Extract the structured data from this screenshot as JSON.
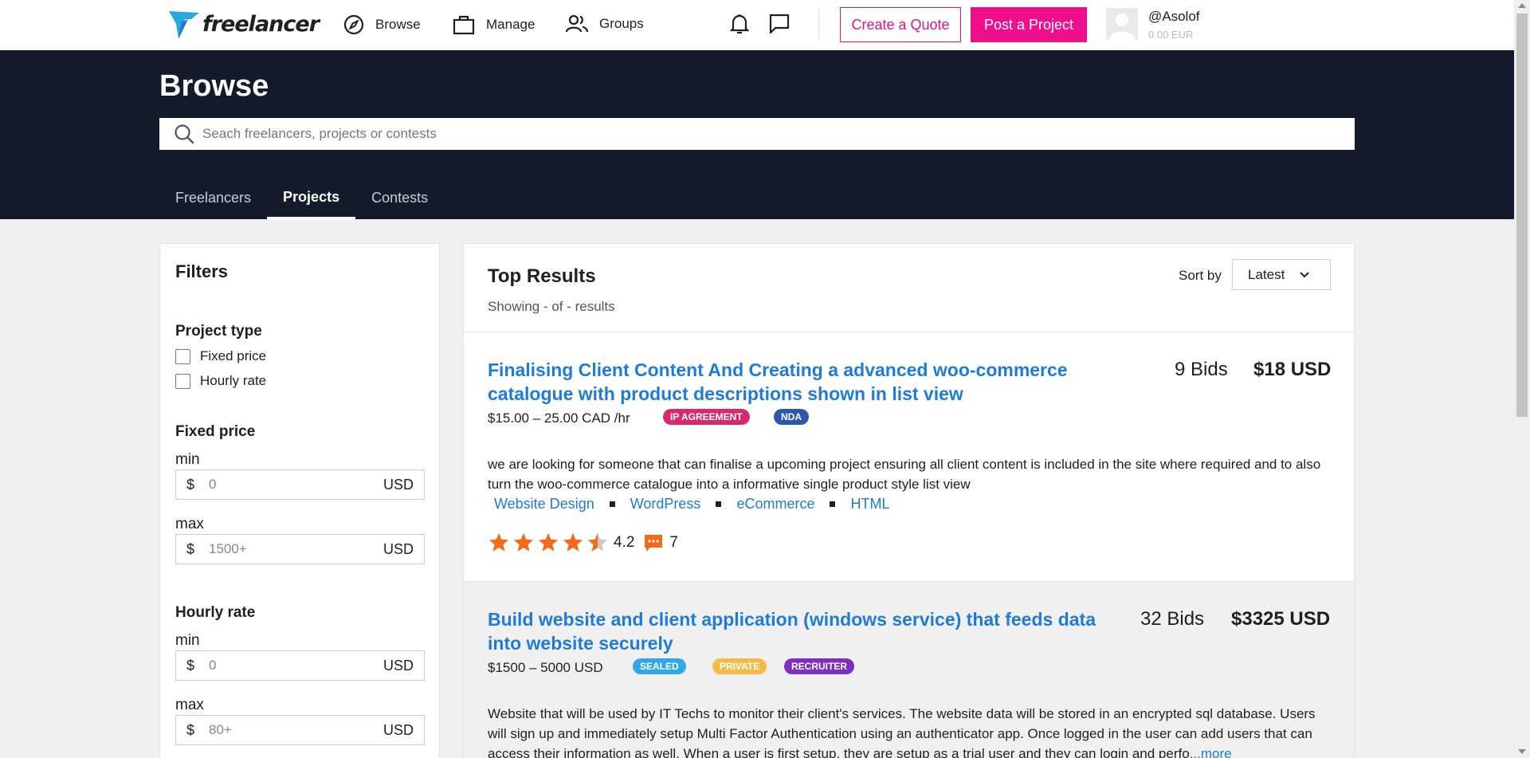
{
  "brand": {
    "name": "freelancer"
  },
  "nav": {
    "browse": "Browse",
    "manage": "Manage",
    "groups": "Groups",
    "create_quote": "Create a Quote",
    "post_project": "Post a Project",
    "username": "@Asolof",
    "balance": "0.00 EUR"
  },
  "header": {
    "title": "Browse",
    "search_placeholder": "Seach freelancers, projects or contests",
    "tabs": [
      {
        "label": "Freelancers",
        "active": false
      },
      {
        "label": "Projects",
        "active": true
      },
      {
        "label": "Contests",
        "active": false
      }
    ]
  },
  "filters": {
    "title": "Filters",
    "project_type": {
      "title": "Project type",
      "options": [
        "Fixed price",
        "Hourly rate"
      ]
    },
    "fixed_price": {
      "title": "Fixed price",
      "min_label": "min",
      "max_label": "max",
      "min_placeholder": "0",
      "max_placeholder": "1500+",
      "currency_symbol": "$",
      "currency": "USD"
    },
    "hourly_rate": {
      "title": "Hourly rate",
      "min_label": "min",
      "max_label": "max",
      "min_placeholder": "0",
      "max_placeholder": "80+",
      "currency_symbol": "$",
      "currency": "USD"
    }
  },
  "results": {
    "title": "Top Results",
    "count": "Showing - of - results",
    "sort_label": "Sort by",
    "sort_value": "Latest",
    "projects": [
      {
        "title": "Finalising Client Content And Creating a advanced woo-commerce catalogue with product descriptions shown in list view",
        "bids": "9 Bids",
        "price": "$18 USD",
        "budget": "$15.00 – 25.00 CAD /hr",
        "badges": [
          {
            "label": "IP AGREEMENT",
            "color": "#d9286c"
          },
          {
            "label": "NDA",
            "color": "#2b58ab"
          }
        ],
        "description": "we are looking for someone that can finalise a upcoming project ensuring all client content is included in the site where required and to also turn the woo-commerce catalogue into a informative single product style list view",
        "skills": [
          "Website Design",
          "WordPress",
          "eCommerce",
          "HTML"
        ],
        "rating": "4.2",
        "rating_value": 4.2,
        "reviews": "7"
      },
      {
        "title": "Build website and client application (windows service) that feeds data into website securely",
        "bids": "32 Bids",
        "price": "$3325 USD",
        "budget": "$1500 – 5000 USD",
        "badges": [
          {
            "label": "SEALED",
            "color": "#32a8e8"
          },
          {
            "label": "PRIVATE",
            "color": "#f3bc49"
          },
          {
            "label": "RECRUITER",
            "color": "#7d2fbf"
          }
        ],
        "description": "Website that will be used by IT Techs to monitor their client's services. The website data will be stored in an encrypted sql database. Users will sign up and immediately setup Multi Factor Authentication using an authenticator app. Once logged in the user can add users that can access their information as well. When a user is first setup, they are setup as a trial user and they can login and perfo",
        "more": "...more"
      }
    ]
  },
  "colors": {
    "brand_pink": "#f00f8a",
    "link_blue": "#1e7cd8",
    "header_dark": "#141c2b",
    "star_orange": "#f36b18"
  }
}
